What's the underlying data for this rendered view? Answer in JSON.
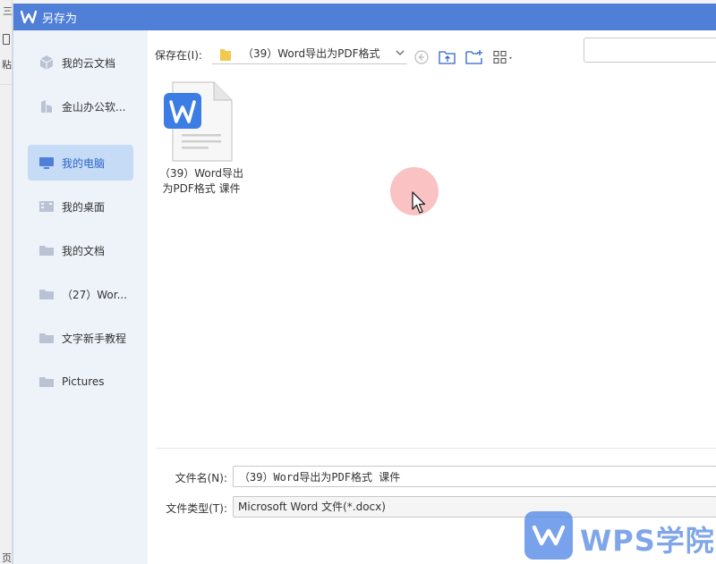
{
  "background_app": {
    "menu_glyph": "三",
    "side_text_top": "粘",
    "side_text_bottom": "页"
  },
  "dialog": {
    "title": "另存为",
    "sidebar": {
      "items": [
        {
          "label": "我的云文档",
          "icon": "cloud-cube-icon",
          "active": false
        },
        {
          "label": "金山办公软...",
          "icon": "building-icon",
          "active": false
        },
        {
          "label": "我的电脑",
          "icon": "monitor-icon",
          "active": true
        },
        {
          "label": "我的桌面",
          "icon": "desktop-icon",
          "active": false
        },
        {
          "label": "我的文档",
          "icon": "folder-icon",
          "active": false
        },
        {
          "label": "（27）Wor...",
          "icon": "folder-icon",
          "active": false
        },
        {
          "label": "文字新手教程",
          "icon": "folder-icon",
          "active": false
        },
        {
          "label": "Pictures",
          "icon": "folder-icon",
          "active": false
        }
      ]
    },
    "toolbar": {
      "save_in_label": "保存在(I):",
      "path": "（39）Word导出为PDF格式",
      "search_placeholder": ""
    },
    "files": [
      {
        "name": "（39）Word导出为PDF格式 课件",
        "type": "word-document-icon"
      }
    ],
    "form": {
      "filename_label": "文件名(N):",
      "filename_value": "（39）Word导出为PDF格式 课件",
      "filetype_label": "文件类型(T):",
      "filetype_value": "Microsoft Word 文件(*.docx)"
    }
  },
  "watermark": {
    "text": "WPS学院"
  },
  "colors": {
    "titlebar": "#4f7fd6",
    "sidebar_bg": "#eef3fa",
    "sidebar_active": "#c5dbf6",
    "accent": "#2d64c6",
    "folder": "#b9c3d3"
  }
}
